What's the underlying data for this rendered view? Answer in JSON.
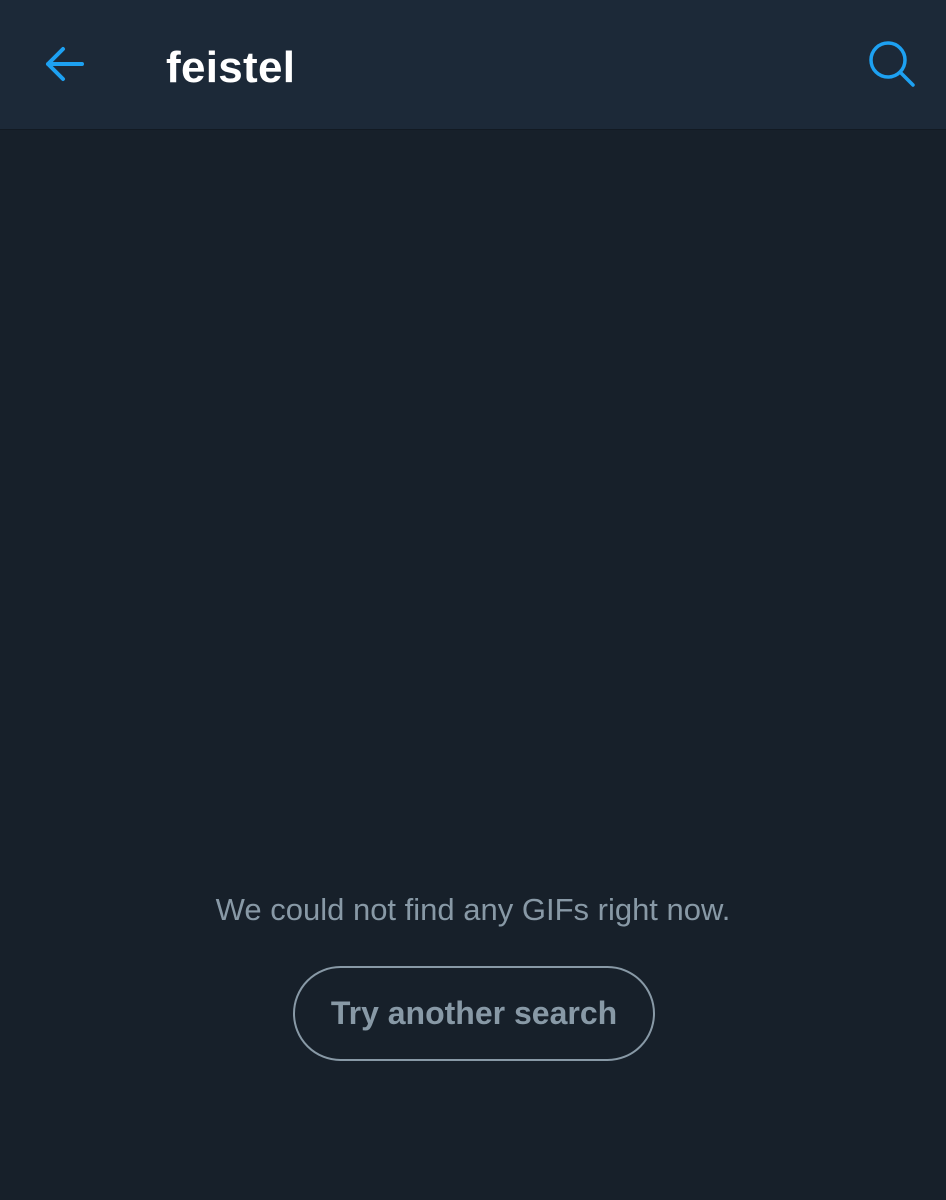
{
  "header": {
    "back_icon": "arrow-left-icon",
    "query": "feistel",
    "search_icon": "search-icon"
  },
  "empty_state": {
    "message": "We could not find any GIFs right now.",
    "button_label": "Try another search"
  },
  "colors": {
    "background": "#17202a",
    "header_background": "#1c2938",
    "accent": "#1da1f2",
    "secondary_text": "#8899a6",
    "primary_text": "#ffffff"
  }
}
